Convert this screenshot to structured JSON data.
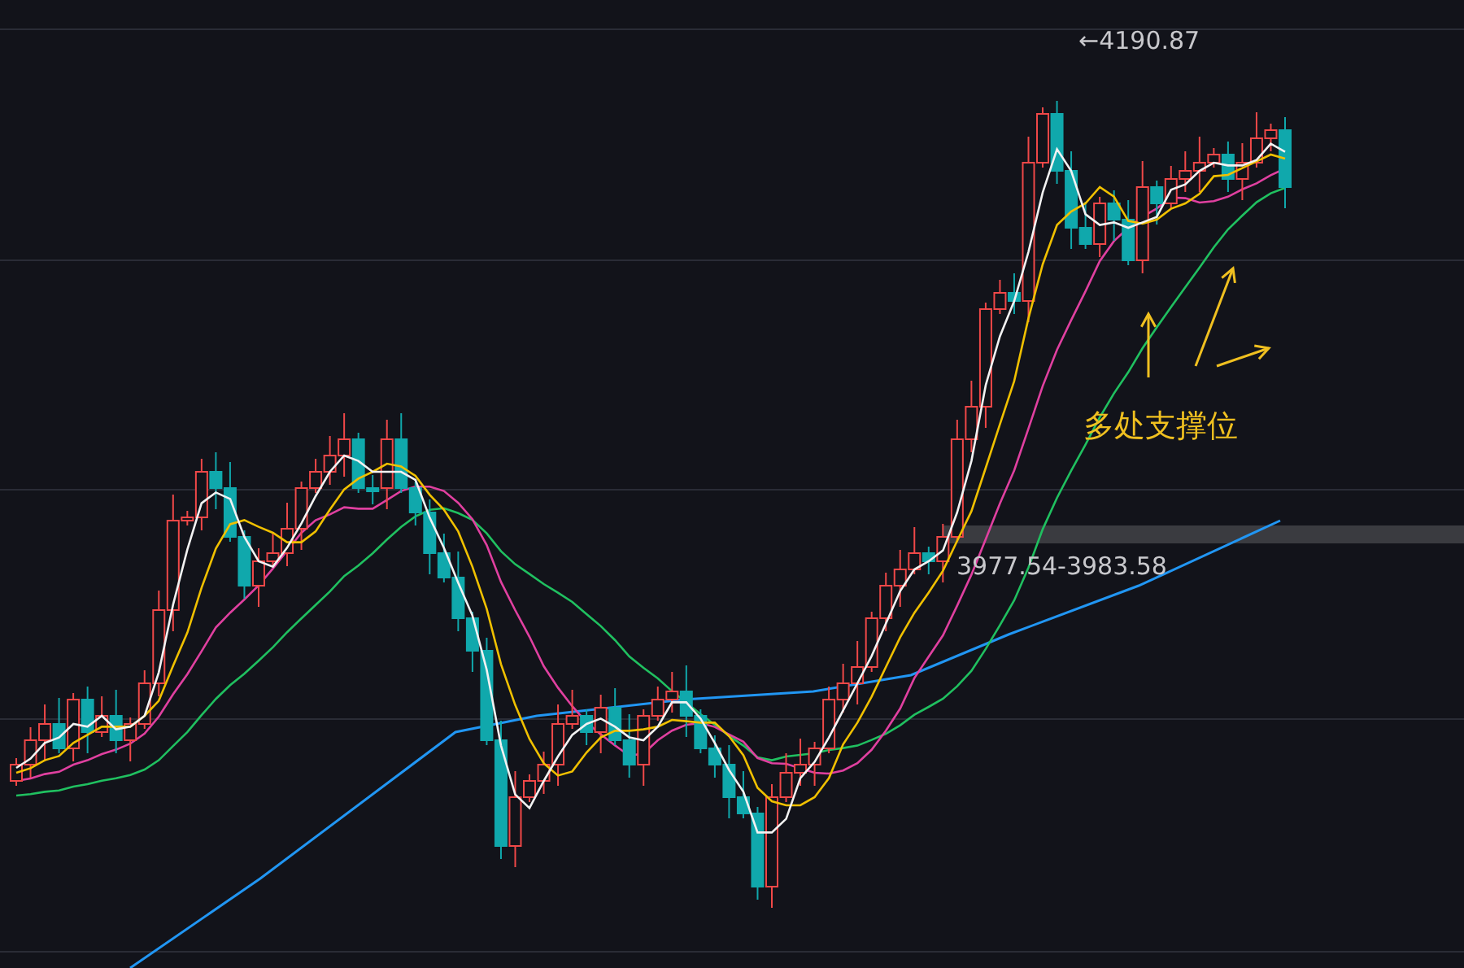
{
  "chart": {
    "high_label": "←4190.87",
    "range_label": "3977.54-3983.58",
    "annotation": "多处支撑位"
  }
}
